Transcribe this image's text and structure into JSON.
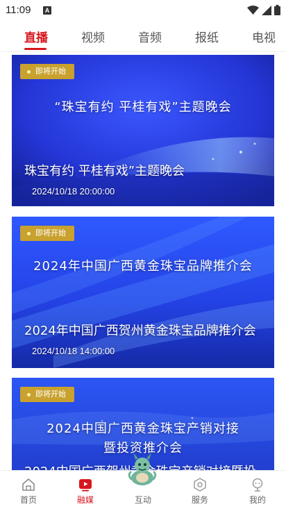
{
  "status_bar": {
    "time": "11:09",
    "notification_icon": "A"
  },
  "tabs": [
    {
      "label": "直播",
      "active": true
    },
    {
      "label": "视频",
      "active": false
    },
    {
      "label": "音频",
      "active": false
    },
    {
      "label": "报纸",
      "active": false
    },
    {
      "label": "电视",
      "active": false
    }
  ],
  "cards": [
    {
      "badge": "即将开始",
      "heading": "“珠宝有约  平桂有戏”主题晚会",
      "title": "珠宝有约 平桂有戏”主题晚会",
      "date": "2024/10/18 20:00:00"
    },
    {
      "badge": "即将开始",
      "heading": "2024年中国广西黄金珠宝品牌推介会",
      "title": "2024年中国广西贺州黄金珠宝品牌推介会",
      "date": "2024/10/18 14:00:00"
    },
    {
      "badge": "即将开始",
      "heading_line1": "2024中国广西黄金珠宝产销对接",
      "heading_line2": "暨投资推介会",
      "title": "2024中国广西贺州黄金珠宝产销对接暨投"
    }
  ],
  "bottom_nav": [
    {
      "label": "首页",
      "icon": "home-icon",
      "active": false
    },
    {
      "label": "融媒",
      "icon": "media-play-icon",
      "active": true
    },
    {
      "label": "互动",
      "icon": "mascot-icon",
      "active": false
    },
    {
      "label": "服务",
      "icon": "service-icon",
      "active": false
    },
    {
      "label": "我的",
      "icon": "profile-icon",
      "active": false
    }
  ],
  "colors": {
    "accent": "#d7161e",
    "badge": "#c9a12e",
    "card_blue": "#2a3fd8"
  }
}
